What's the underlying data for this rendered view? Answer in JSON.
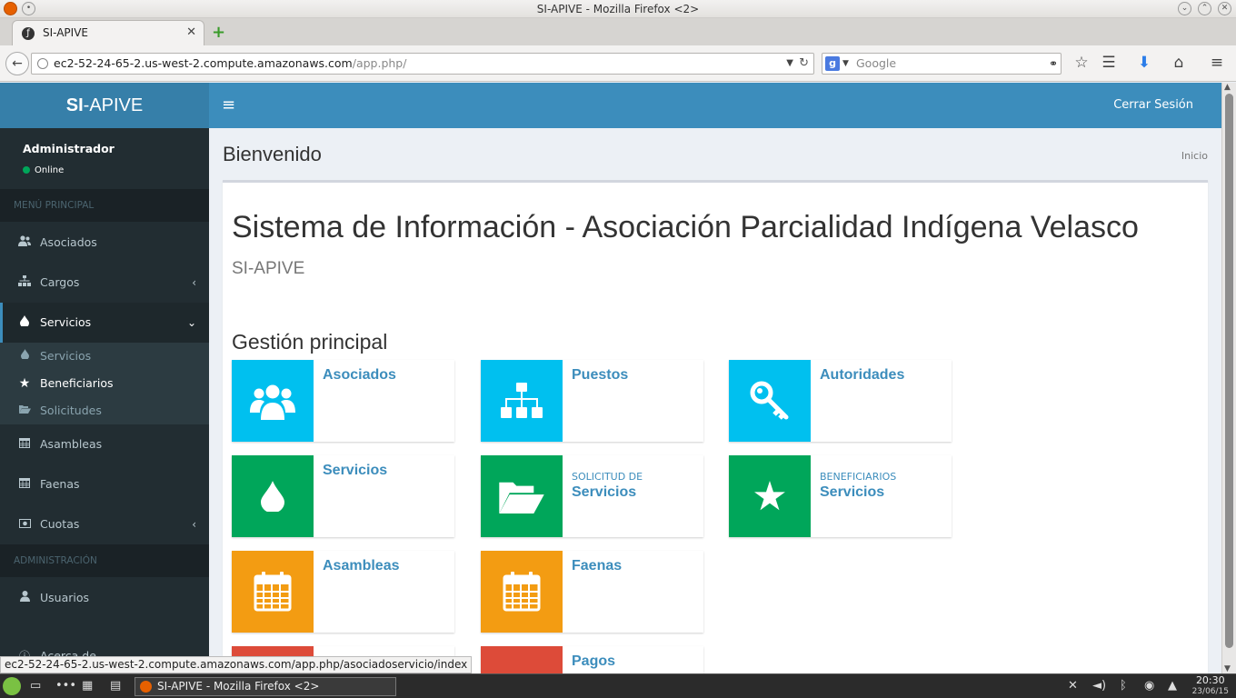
{
  "window": {
    "title": "SI-APIVE - Mozilla Firefox <2>"
  },
  "browser": {
    "tab_label": "SI-APIVE",
    "url_host": "ec2-52-24-65-2.us-west-2.compute.amazonaws.com",
    "url_path": "/app.php/",
    "search_placeholder": "Google",
    "status_url": "ec2-52-24-65-2.us-west-2.compute.amazonaws.com/app.php/asociadoservicio/index"
  },
  "app": {
    "logo_bold": "SI",
    "logo_rest": "-APIVE",
    "logout": "Cerrar Sesión"
  },
  "sidebar": {
    "user_name": "Administrador",
    "user_status": "Online",
    "section_main": "MENÚ PRINCIPAL",
    "section_admin": "ADMINISTRACIÓN",
    "items": [
      {
        "label": "Asociados",
        "icon": "users-icon"
      },
      {
        "label": "Cargos",
        "icon": "sitemap-icon"
      },
      {
        "label": "Servicios",
        "icon": "tint-icon"
      },
      {
        "label": "Asambleas",
        "icon": "calendar-icon"
      },
      {
        "label": "Faenas",
        "icon": "calendar-icon"
      },
      {
        "label": "Cuotas",
        "icon": "money-icon"
      },
      {
        "label": "Usuarios",
        "icon": "user-icon"
      },
      {
        "label": "Acerca de",
        "icon": "info-icon"
      }
    ],
    "subitems": [
      {
        "label": "Servicios",
        "icon": "tint-icon"
      },
      {
        "label": "Beneficiarios",
        "icon": "star-icon"
      },
      {
        "label": "Solicitudes",
        "icon": "folder-open-icon"
      }
    ]
  },
  "content": {
    "page_title": "Bienvenido",
    "breadcrumb": "Inicio",
    "heading": "Sistema de Información - Asociación Parcialidad Indígena Velasco",
    "subheading": "SI-APIVE",
    "section_title": "Gestión principal",
    "cards": [
      {
        "label": "",
        "title": "Asociados",
        "color": "#00c0ef",
        "icon": "users-icon"
      },
      {
        "label": "",
        "title": "Puestos",
        "color": "#00c0ef",
        "icon": "sitemap-icon"
      },
      {
        "label": "",
        "title": "Autoridades",
        "color": "#00c0ef",
        "icon": "key-icon"
      },
      {
        "label": "",
        "title": "Servicios",
        "color": "#00a65a",
        "icon": "tint-icon"
      },
      {
        "label": "SOLICITUD DE",
        "title": "Servicios",
        "color": "#00a65a",
        "icon": "folder-open-icon"
      },
      {
        "label": "BENEFICIARIOS",
        "title": "Servicios",
        "color": "#00a65a",
        "icon": "star-icon"
      },
      {
        "label": "",
        "title": "Asambleas",
        "color": "#f39c12",
        "icon": "calendar-icon"
      },
      {
        "label": "",
        "title": "Faenas",
        "color": "#f39c12",
        "icon": "calendar-icon"
      },
      {
        "label": "",
        "title": "",
        "color": "#dd4b39",
        "icon": "unknown-icon"
      },
      {
        "label": "",
        "title": "Pagos",
        "color": "#dd4b39",
        "icon": "money-icon"
      }
    ]
  },
  "taskbar": {
    "window_label": "SI-APIVE - Mozilla Firefox <2>",
    "time": "20:30",
    "date": "23/06/15"
  }
}
